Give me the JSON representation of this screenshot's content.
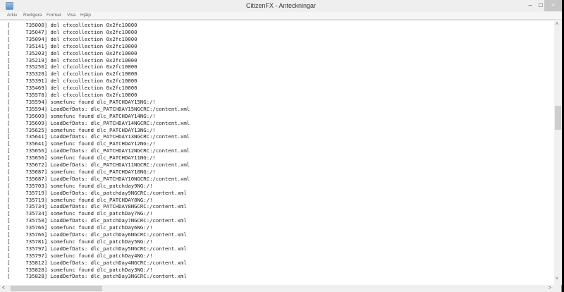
{
  "window": {
    "title": "CitizenFX - Anteckningar",
    "minimize": "–",
    "maximize": "□",
    "close": "×"
  },
  "menu": [
    "Arkiv",
    "Redigera",
    "Format",
    "Visa",
    "Hjälp"
  ],
  "lines": [
    "[     735000] del cfxcollection 0x2fc10000",
    "[     735047] del cfxcollection 0x2fc10000",
    "[     735094] del cfxcollection 0x2fc10000",
    "[     735141] del cfxcollection 0x2fc10000",
    "[     735203] del cfxcollection 0x2fc10000",
    "[     735219] del cfxcollection 0x2fc10000",
    "[     735250] del cfxcollection 0x2fc10000",
    "[     735328] del cfxcollection 0x2fc10000",
    "[     735391] del cfxcollection 0x2fc10000",
    "[     735469] del cfxcollection 0x2fc10000",
    "[     735578] del cfxcollection 0x2fc10000",
    "[     735594] somefunc found dlc_PATCHDAY15NG:/!",
    "[     735594] LoadDefDats: dlc_PATCHDAY15NGCRC:/content.xml",
    "[     735609] somefunc found dlc_PATCHDAY14NG:/!",
    "[     735609] LoadDefDats: dlc_PATCHDAY14NGCRC:/content.xml",
    "[     735625] somefunc found dlc_PATCHDAY13NG:/!",
    "[     735641] LoadDefDats: dlc_PATCHDAY13NGCRC:/content.xml",
    "[     735641] somefunc found dlc_PATCHDAY12NG:/!",
    "[     735656] LoadDefDats: dlc_PATCHDAY12NGCRC:/content.xml",
    "[     735656] somefunc found dlc_PATCHDAY11NG:/!",
    "[     735672] LoadDefDats: dlc_PATCHDAY11NGCRC:/content.xml",
    "[     735687] somefunc found dlc_PATCHDAY10NG:/!",
    "[     735687] LoadDefDats: dlc_PATCHDAY10NGCRC:/content.xml",
    "[     735703] somefunc found dlc_patchday9NG:/!",
    "[     735719] LoadDefDats: dlc_patchday9NGCRC:/content.xml",
    "[     735719] somefunc found dlc_PATCHDAY8NG:/!",
    "[     735734] LoadDefDats: dlc_PATCHDAY8NGCRC:/content.xml",
    "[     735734] somefunc found dlc_patchDay7NG:/!",
    "[     735750] LoadDefDats: dlc_patchDay7NGCRC:/content.xml",
    "[     735766] somefunc found dlc_patchDay6NG:/!",
    "[     735766] LoadDefDats: dlc_patchDay6NGCRC:/content.xml",
    "[     735781] somefunc found dlc_patchDay5NG:/!",
    "[     735797] LoadDefDats: dlc_patchDay5NGCRC:/content.xml",
    "[     735797] somefunc found dlc_patchDay4NG:/!",
    "[     735812] LoadDefDats: dlc_patchDay4NGCRC:/content.xml",
    "[     735828] somefunc found dlc_patchDay3NG:/!",
    "[     735828] LoadDefDats: dlc_patchDay3NGCRC:/content.xml"
  ],
  "scrollbars": {
    "up": "˄",
    "down": "˅",
    "left": "<",
    "right": ">"
  }
}
